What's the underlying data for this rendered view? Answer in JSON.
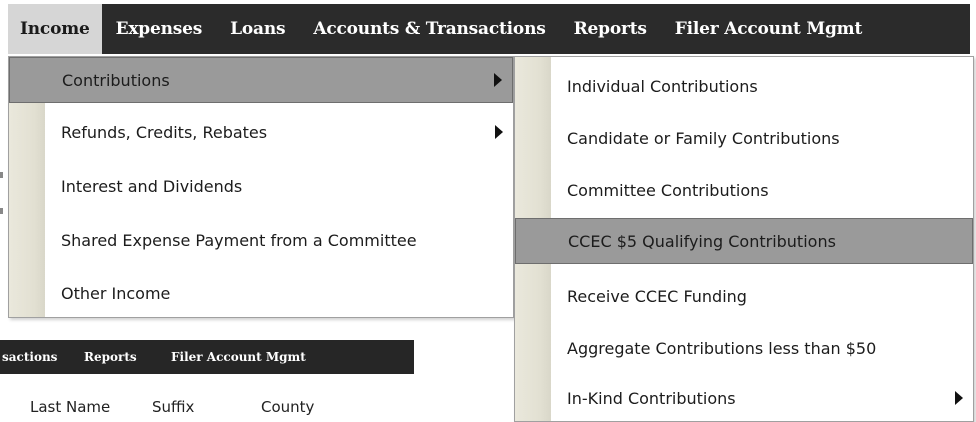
{
  "menubar": {
    "items": [
      {
        "label": "Income"
      },
      {
        "label": "Expenses"
      },
      {
        "label": "Loans"
      },
      {
        "label": "Accounts & Transactions"
      },
      {
        "label": "Reports"
      },
      {
        "label": "Filer Account Mgmt"
      }
    ]
  },
  "income_menu": {
    "items": [
      {
        "label": "Contributions"
      },
      {
        "label": "Refunds, Credits, Rebates"
      },
      {
        "label": "Interest and Dividends"
      },
      {
        "label": "Shared Expense Payment from a Committee"
      },
      {
        "label": "Other Income"
      }
    ]
  },
  "contributions_menu": {
    "items": [
      {
        "label": "Individual Contributions"
      },
      {
        "label": "Candidate or Family Contributions"
      },
      {
        "label": "Committee Contributions"
      },
      {
        "label": "CCEC $5 Qualifying Contributions"
      },
      {
        "label": "Receive CCEC Funding"
      },
      {
        "label": "Aggregate Contributions less than $50"
      },
      {
        "label": "In-Kind Contributions"
      }
    ]
  },
  "inset": {
    "menubar": {
      "items": [
        {
          "label": "sactions"
        },
        {
          "label": "Reports"
        },
        {
          "label": "Filer Account Mgmt"
        }
      ]
    },
    "headers": [
      {
        "label": "Last Name"
      },
      {
        "label": "Suffix"
      },
      {
        "label": "County"
      }
    ]
  }
}
